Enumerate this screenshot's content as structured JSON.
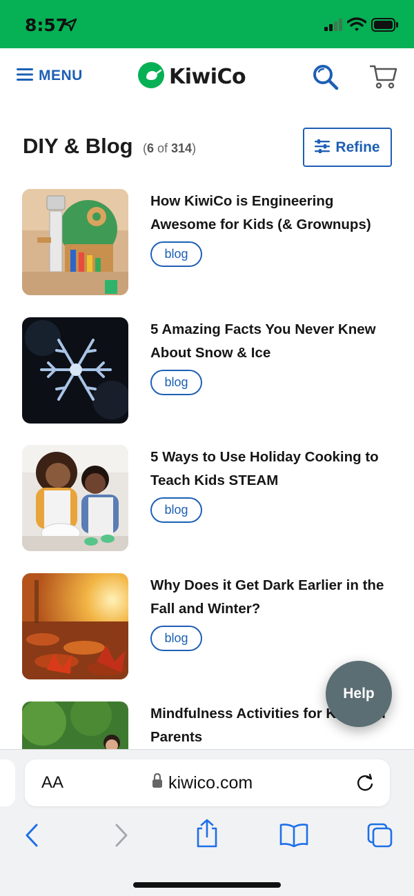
{
  "status_bar": {
    "time": "8:57"
  },
  "header": {
    "menu_label": "MENU",
    "logo_text": "KiwiCo",
    "icons": [
      "hamburger-icon",
      "kiwi-logo-icon",
      "search-icon",
      "cart-icon"
    ]
  },
  "page": {
    "title": "DIY & Blog",
    "count_open": "(",
    "count_shown": "6",
    "count_of": " of ",
    "count_total": "314",
    "count_close": ")",
    "refine_label": "Refine"
  },
  "articles": [
    {
      "title": "How KiwiCo is Engineering Awesome for Kids (& Grownups)",
      "tag": "blog"
    },
    {
      "title": "5 Amazing Facts You Never Knew About Snow & Ice",
      "tag": "blog"
    },
    {
      "title": "5 Ways to Use Holiday Cooking to Teach Kids STEAM",
      "tag": "blog"
    },
    {
      "title": "Why Does it Get Dark Earlier in the Fall and Winter?",
      "tag": "blog"
    },
    {
      "title": "Mindfulness Activities for Kids and Parents",
      "tag": ""
    }
  ],
  "help_label": "Help",
  "browser": {
    "text_size_label": "AA",
    "url": "kiwico.com",
    "nav_icons": [
      "back-icon",
      "forward-icon",
      "share-icon",
      "bookmarks-icon",
      "tabs-icon"
    ]
  },
  "colors": {
    "status_bar": "#06b054",
    "brand_blue": "#1d5fb4",
    "logo_green": "#06b054",
    "help_button": "#5b6e74"
  }
}
